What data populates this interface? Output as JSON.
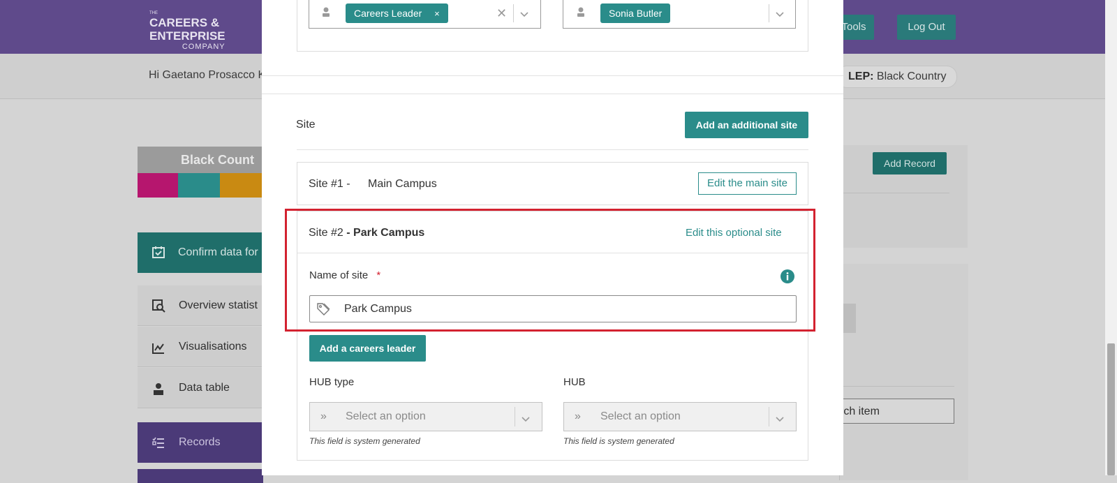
{
  "header": {
    "logo": {
      "line_the": "THE",
      "line1": "CAREERS &",
      "line2": "ENTERPRISE",
      "line3": "COMPANY"
    },
    "buttons": [
      "Tools",
      "Log Out"
    ],
    "greeting": "Hi Gaetano Prosacco K",
    "lep_label": "LEP:",
    "lep_value": "Black Country"
  },
  "sidebar": {
    "banner": "Black Count",
    "swatch_colors": [
      "#b6166e",
      "#2a8c8a",
      "#c98a12"
    ],
    "confirm_label": "Confirm data for",
    "items": [
      {
        "label": "Overview statist",
        "icon": "search-chart-icon"
      },
      {
        "label": "Visualisations",
        "icon": "chart-icon"
      },
      {
        "label": "Data table",
        "icon": "user-table-icon"
      }
    ],
    "records_label": "Records"
  },
  "right_panel": {
    "add_record": "Add Record",
    "search_partial": "rch item"
  },
  "modal": {
    "contact_select_left": {
      "tag": "Careers Leader",
      "icon": "person-icon"
    },
    "contact_select_right": {
      "tag": "Sonia Butler",
      "icon": "person-icon"
    },
    "site_section": {
      "title": "Site",
      "add_site_button": "Add an additional site",
      "site1": {
        "prefix": "Site #1 -",
        "name": "Main Campus",
        "edit_button": "Edit the main site"
      },
      "site2": {
        "prefix": "Site #2",
        "name": "- Park Campus",
        "edit_link": "Edit this optional site"
      },
      "name_field": {
        "label": "Name of site",
        "required_mark": "*",
        "value": "Park Campus",
        "info_icon": "info-icon"
      },
      "add_careers_leader_button": "Add a careers leader",
      "hub_type": {
        "label": "HUB type",
        "placeholder": "Select an option",
        "hint": "This field is system generated"
      },
      "hub": {
        "label": "HUB",
        "placeholder": "Select an option",
        "hint": "This field is system generated"
      }
    }
  },
  "colors": {
    "accent_teal": "#2a8c8a",
    "header_purple": "#5f4a8b",
    "highlight_red": "#d32230"
  }
}
